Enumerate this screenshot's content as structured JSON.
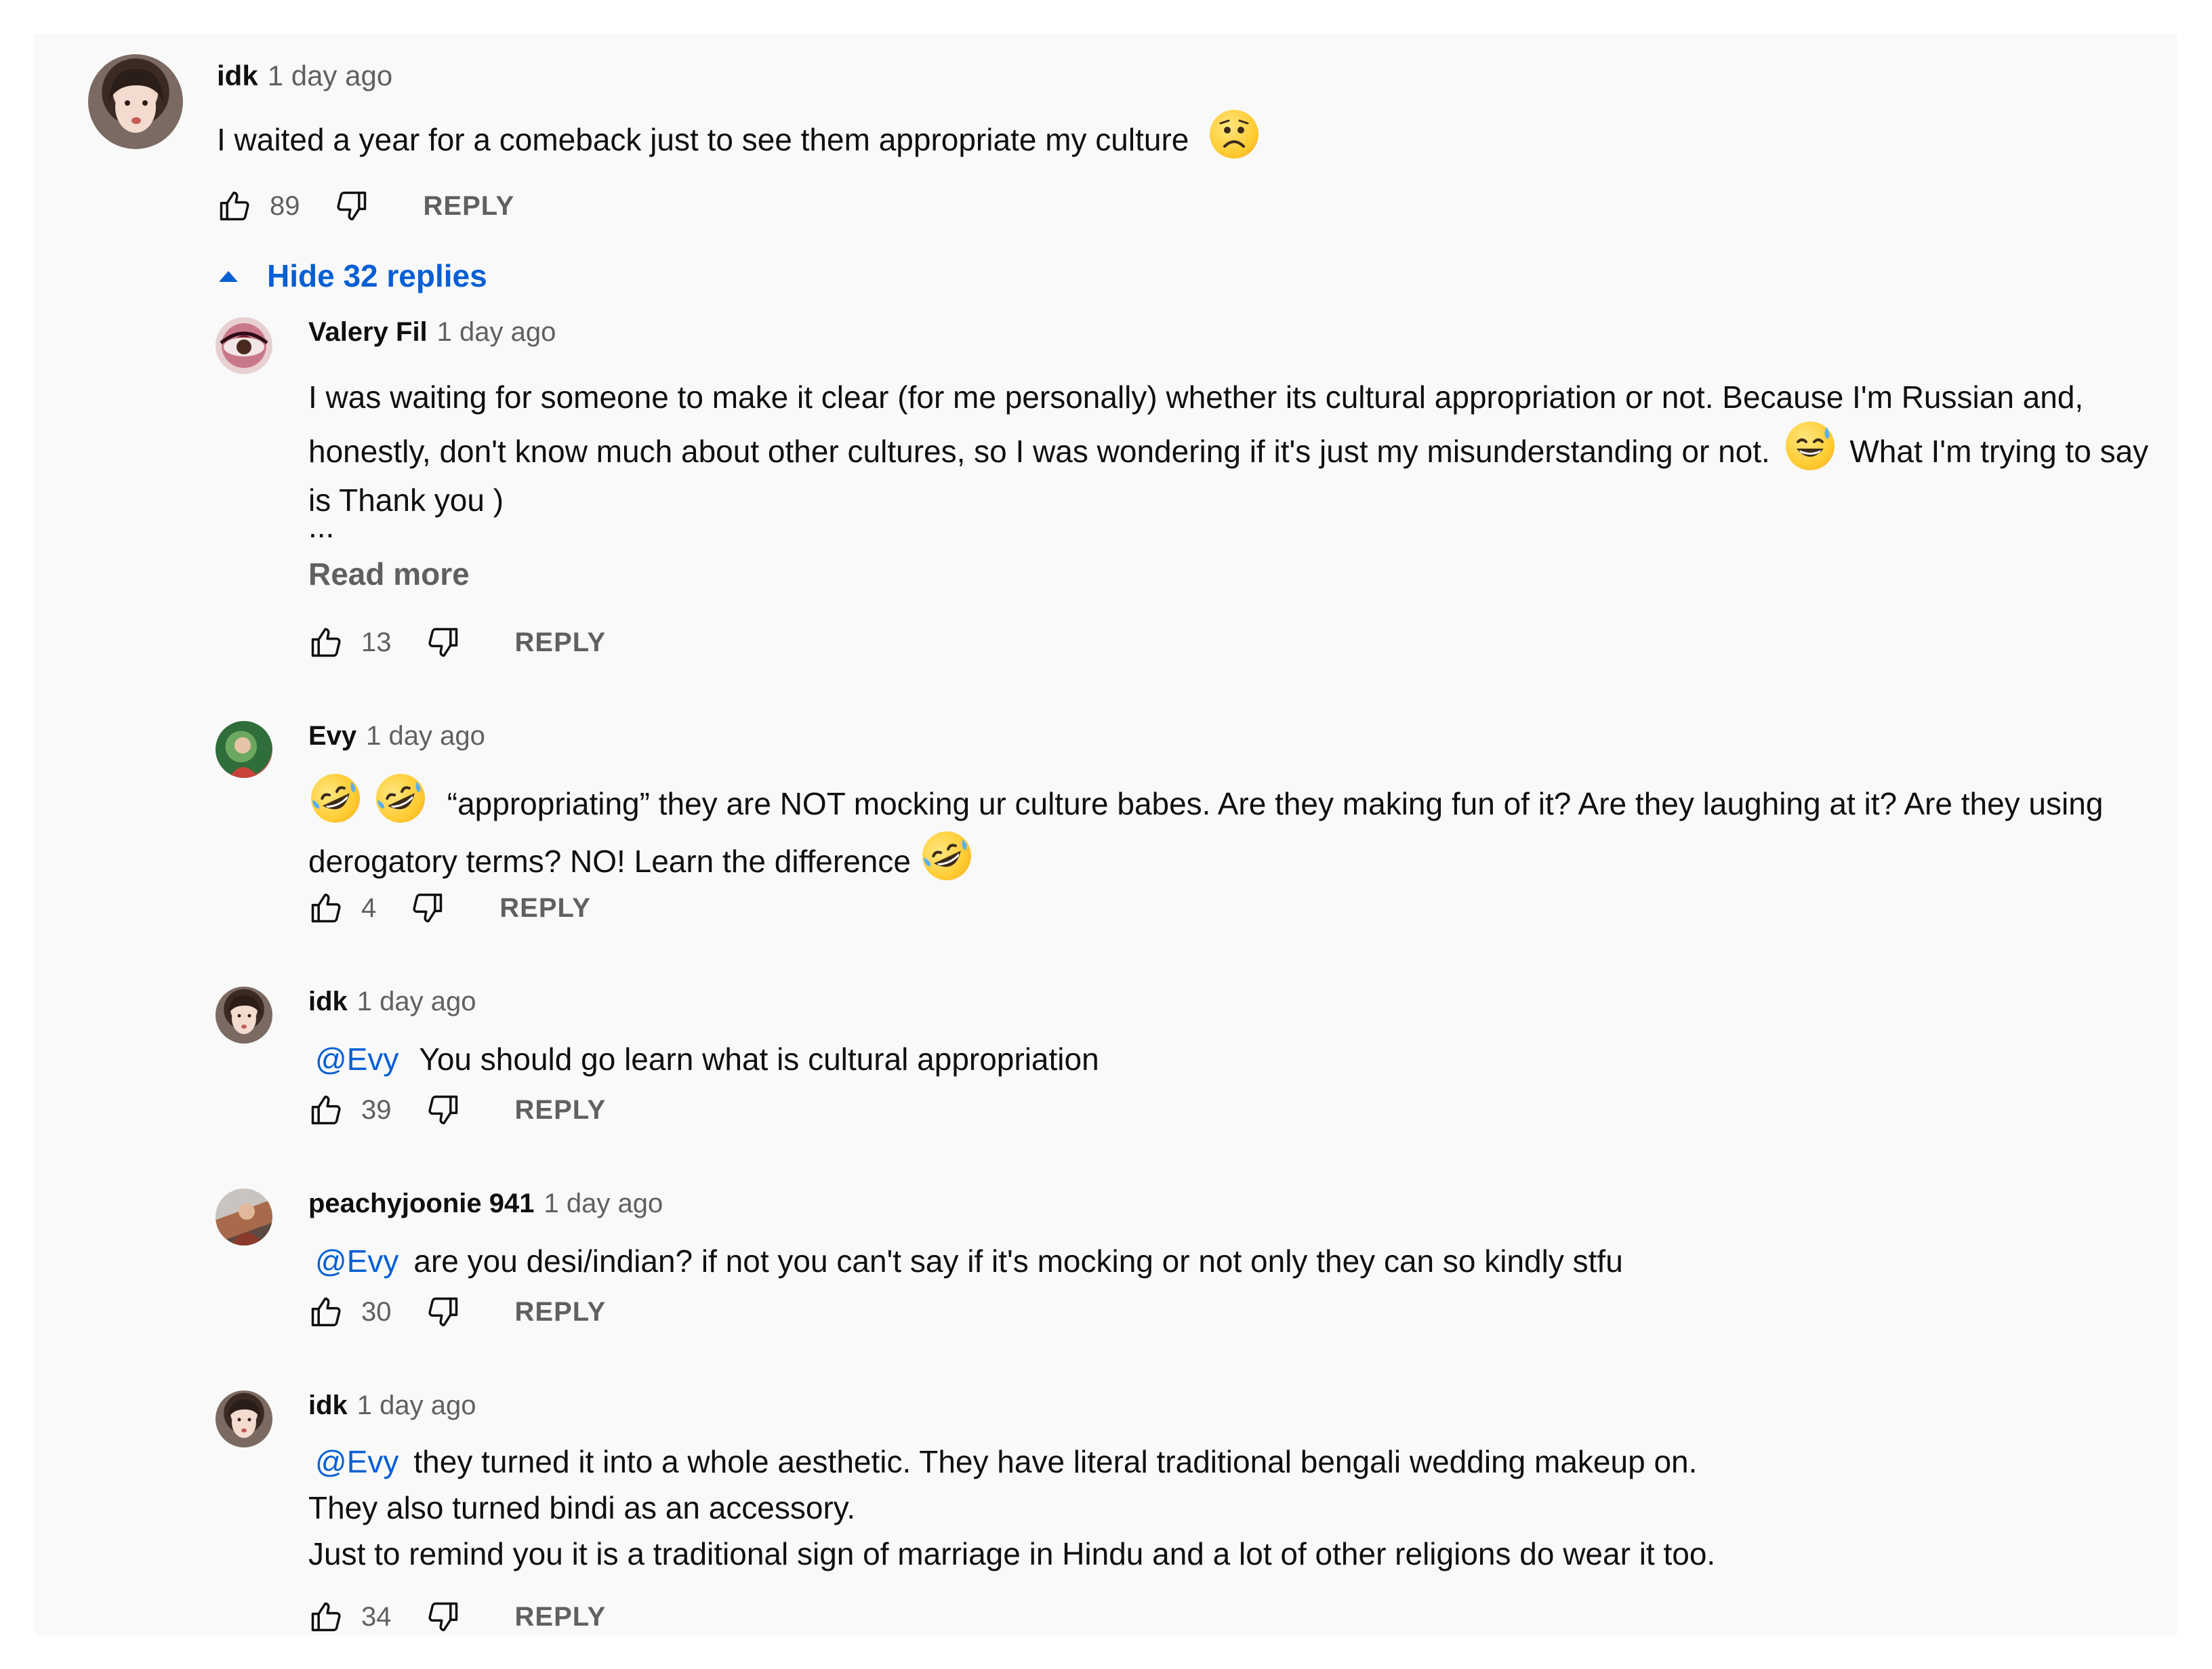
{
  "top_comment": {
    "author": "idk",
    "time": "1 day ago",
    "text": "I waited a year for a comeback just to see them appropriate my culture",
    "emoji": "worried-face-emoji",
    "likes": "89",
    "reply_label": "REPLY"
  },
  "toggle_replies_label": "Hide 32 replies",
  "replies": [
    {
      "author": "Valery Fil",
      "time": "1 day ago",
      "text_part1": "I was waiting for someone to make it clear (for me personally) whether its cultural appropriation or not. Because I'm  Russian and, honestly, don't know much about other cultures, so I was wondering if it's just my misunderstanding or not.",
      "text_part2": "What I'm trying to say is Thank you )",
      "emoji": "grinning-face-with-sweat-emoji",
      "ellipsis": "...",
      "read_more": "Read more",
      "likes": "13",
      "reply_label": "REPLY"
    },
    {
      "author": "Evy",
      "time": "1 day ago",
      "text_part1": "“appropriating” they are NOT mocking ur culture babes. Are they making fun of it? Are they laughing at it? Are they using",
      "text_part2": "derogatory terms? NO! Learn the difference",
      "emoji": "rolling-on-the-floor-laughing-emoji",
      "likes": "4",
      "reply_label": "REPLY"
    },
    {
      "author": "idk",
      "time": "1 day ago",
      "mention": "@Evy",
      "text": "You should go learn what is cultural appropriation",
      "likes": "39",
      "reply_label": "REPLY"
    },
    {
      "author": "peachyjoonie 941",
      "time": "1 day ago",
      "mention": "@Evy",
      "text": "are you desi/indian? if not you can't say if it's mocking or not only they can so kindly stfu",
      "likes": "30",
      "reply_label": "REPLY"
    },
    {
      "author": "idk",
      "time": "1 day ago",
      "mention": "@Evy",
      "line1": "they turned it into a whole aesthetic. They have literal traditional bengali wedding makeup on.",
      "line2": "They also turned bindi as an accessory.",
      "line3": "Just to remind you it is a traditional sign of marriage in Hindu and a lot of other religions do wear it too.",
      "likes": "34",
      "reply_label": "REPLY"
    }
  ],
  "colors": {
    "background": "#f9f9f9",
    "link_blue": "#065fd4",
    "secondary_text": "#606060"
  }
}
